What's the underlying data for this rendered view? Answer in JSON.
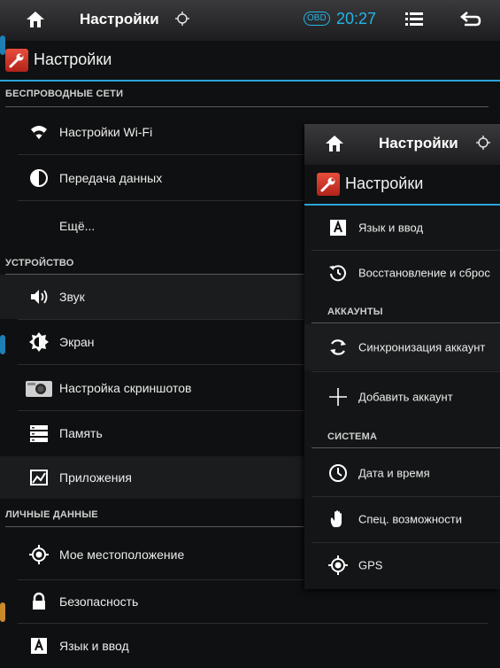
{
  "main": {
    "statusbar": {
      "title": "Настройки",
      "obd": "OBD",
      "time": "20:27"
    },
    "actionbar": {
      "title": "Настройки"
    },
    "sections": {
      "wireless": "БЕСПРОВОДНЫЕ СЕТИ",
      "device": "УСТРОЙСТВО",
      "personal": "ЛИЧНЫЕ ДАННЫЕ"
    },
    "items": {
      "wifi": "Настройки Wi-Fi",
      "data": "Передача данных",
      "more": "Ещё...",
      "sound": "Звук",
      "screen": "Экран",
      "screenshots": "Настройка скриншотов",
      "memory": "Память",
      "apps": "Приложения",
      "location": "Мое местоположение",
      "security": "Безопасность",
      "language": "Язык и ввод"
    }
  },
  "overlay": {
    "statusbar": {
      "title": "Настройки"
    },
    "actionbar": {
      "title": "Настройки"
    },
    "sections": {
      "accounts": "АККАУНТЫ",
      "system": "СИСТЕМА"
    },
    "items": {
      "language": "Язык и ввод",
      "reset": "Восстановление и сброс",
      "sync": "Синхронизация аккаунт",
      "add_account": "Добавить аккаунт",
      "datetime": "Дата и время",
      "accessibility": "Спец. возможности",
      "gps": "GPS"
    }
  },
  "colors": {
    "accent": "#22b6e6",
    "app_icon": "#d8382a"
  }
}
